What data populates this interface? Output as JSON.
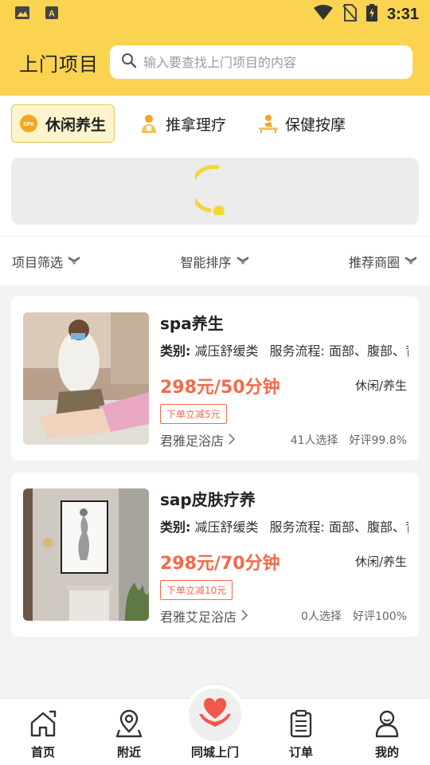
{
  "status_bar": {
    "time": "3:31"
  },
  "header": {
    "title": "上门项目",
    "search_placeholder": "输入要查找上门项目的内容"
  },
  "tabs": [
    {
      "label": "休闲养生",
      "icon": "spa-icon",
      "badge": "SPA",
      "active": true
    },
    {
      "label": "推拿理疗",
      "icon": "therapist-icon",
      "active": false
    },
    {
      "label": "保健按摩",
      "icon": "massage-icon",
      "active": false
    }
  ],
  "filters": [
    {
      "label": "项目筛选"
    },
    {
      "label": "智能排序"
    },
    {
      "label": "推荐商圈"
    }
  ],
  "products": [
    {
      "title": "spa养生",
      "category_label": "类别:",
      "category": "减压舒缓类",
      "flow": "服务流程: 面部、腹部、背部",
      "price": "298元/50分钟",
      "type": "休闲/养生",
      "promo": "下单立减5元",
      "shop": "君雅足浴店",
      "selected": "41人选择",
      "rating": "好评99.8%"
    },
    {
      "title": "sap皮肤疗养",
      "category_label": "类别:",
      "category": "减压舒缓类",
      "flow": "服务流程: 面部、腹部、背部",
      "price": "298元/70分钟",
      "type": "休闲/养生",
      "promo": "下单立减10元",
      "shop": "君雅艾足浴店",
      "selected": "0人选择",
      "rating": "好评100%"
    }
  ],
  "bottom_nav": [
    {
      "label": "首页",
      "icon": "home-icon"
    },
    {
      "label": "附近",
      "icon": "location-icon"
    },
    {
      "label": "同城上门",
      "icon": "heart-hands-icon"
    },
    {
      "label": "订单",
      "icon": "clipboard-icon"
    },
    {
      "label": "我的",
      "icon": "user-icon"
    }
  ],
  "colors": {
    "brand_yellow": "#fad451",
    "price_red": "#f26a4b",
    "tab_active_bg": "#fdf3cd",
    "heart_red": "#f2584a"
  }
}
